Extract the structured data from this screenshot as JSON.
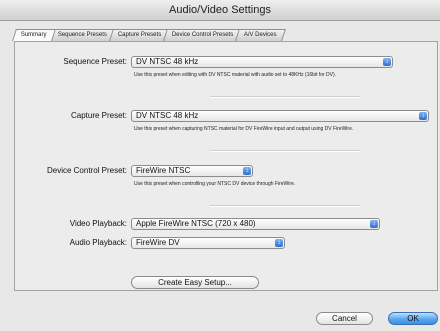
{
  "window": {
    "title": "Audio/Video Settings"
  },
  "tabs": [
    {
      "label": "Summary",
      "active": true
    },
    {
      "label": "Sequence Presets",
      "active": false
    },
    {
      "label": "Capture Presets",
      "active": false
    },
    {
      "label": "Device Control Presets",
      "active": false
    },
    {
      "label": "A/V Devices",
      "active": false
    }
  ],
  "sequence": {
    "label": "Sequence Preset:",
    "value": "DV NTSC 48 kHz",
    "hint": "Use this preset when editing with DV NTSC material with audio set to 48KHz (16bit for DV)."
  },
  "capture": {
    "label": "Capture Preset:",
    "value": "DV NTSC 48 kHz",
    "hint": "Use this preset when capturing NTSC material for DV FireWire input and output using DV FireWire."
  },
  "device_control": {
    "label": "Device Control Preset:",
    "value": "FireWire NTSC",
    "hint": "Use this preset when controlling your NTSC DV device through FireWire."
  },
  "video_playback": {
    "label": "Video Playback:",
    "value": "Apple FireWire NTSC (720 x 480)"
  },
  "audio_playback": {
    "label": "Audio Playback:",
    "value": "FireWire DV"
  },
  "buttons": {
    "easy_setup": "Create Easy Setup...",
    "cancel": "Cancel",
    "ok": "OK"
  },
  "icons": {
    "popup_arrows": "up-down-arrows-icon"
  },
  "colors": {
    "accent": "#3f8fe2",
    "popup_arrow": "#2f6fd0"
  }
}
